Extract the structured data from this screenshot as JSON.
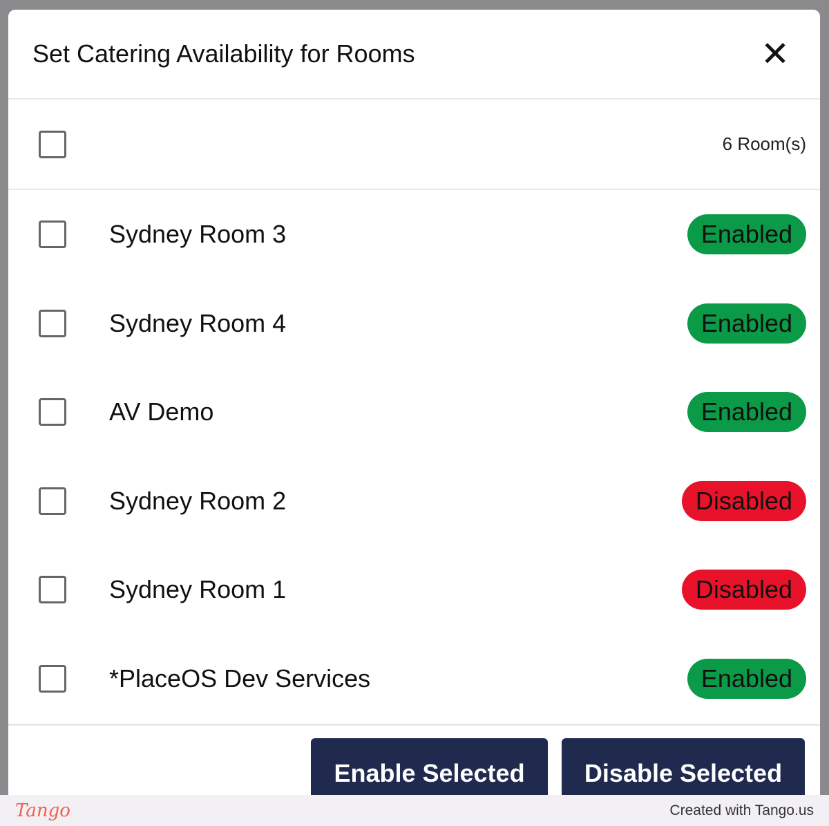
{
  "dialog": {
    "title": "Set Catering Availability for Rooms",
    "close_icon": "close-icon"
  },
  "select_all": {
    "count_label": "6 Room(s)"
  },
  "rooms": [
    {
      "name": "Sydney Room 3",
      "status": "Enabled"
    },
    {
      "name": "Sydney Room 4",
      "status": "Enabled"
    },
    {
      "name": "AV Demo",
      "status": "Enabled"
    },
    {
      "name": "Sydney Room 2",
      "status": "Disabled"
    },
    {
      "name": "Sydney Room 1",
      "status": "Disabled"
    },
    {
      "name": "*PlaceOS Dev Services",
      "status": "Enabled"
    }
  ],
  "colors": {
    "enabled": "#0b9a47",
    "disabled": "#e8132b",
    "button": "#1f2a4e"
  },
  "actions": {
    "enable_label": "Enable Selected",
    "disable_label": "Disable Selected"
  },
  "watermark": {
    "logo": "Tango",
    "credit": "Created with Tango.us"
  }
}
